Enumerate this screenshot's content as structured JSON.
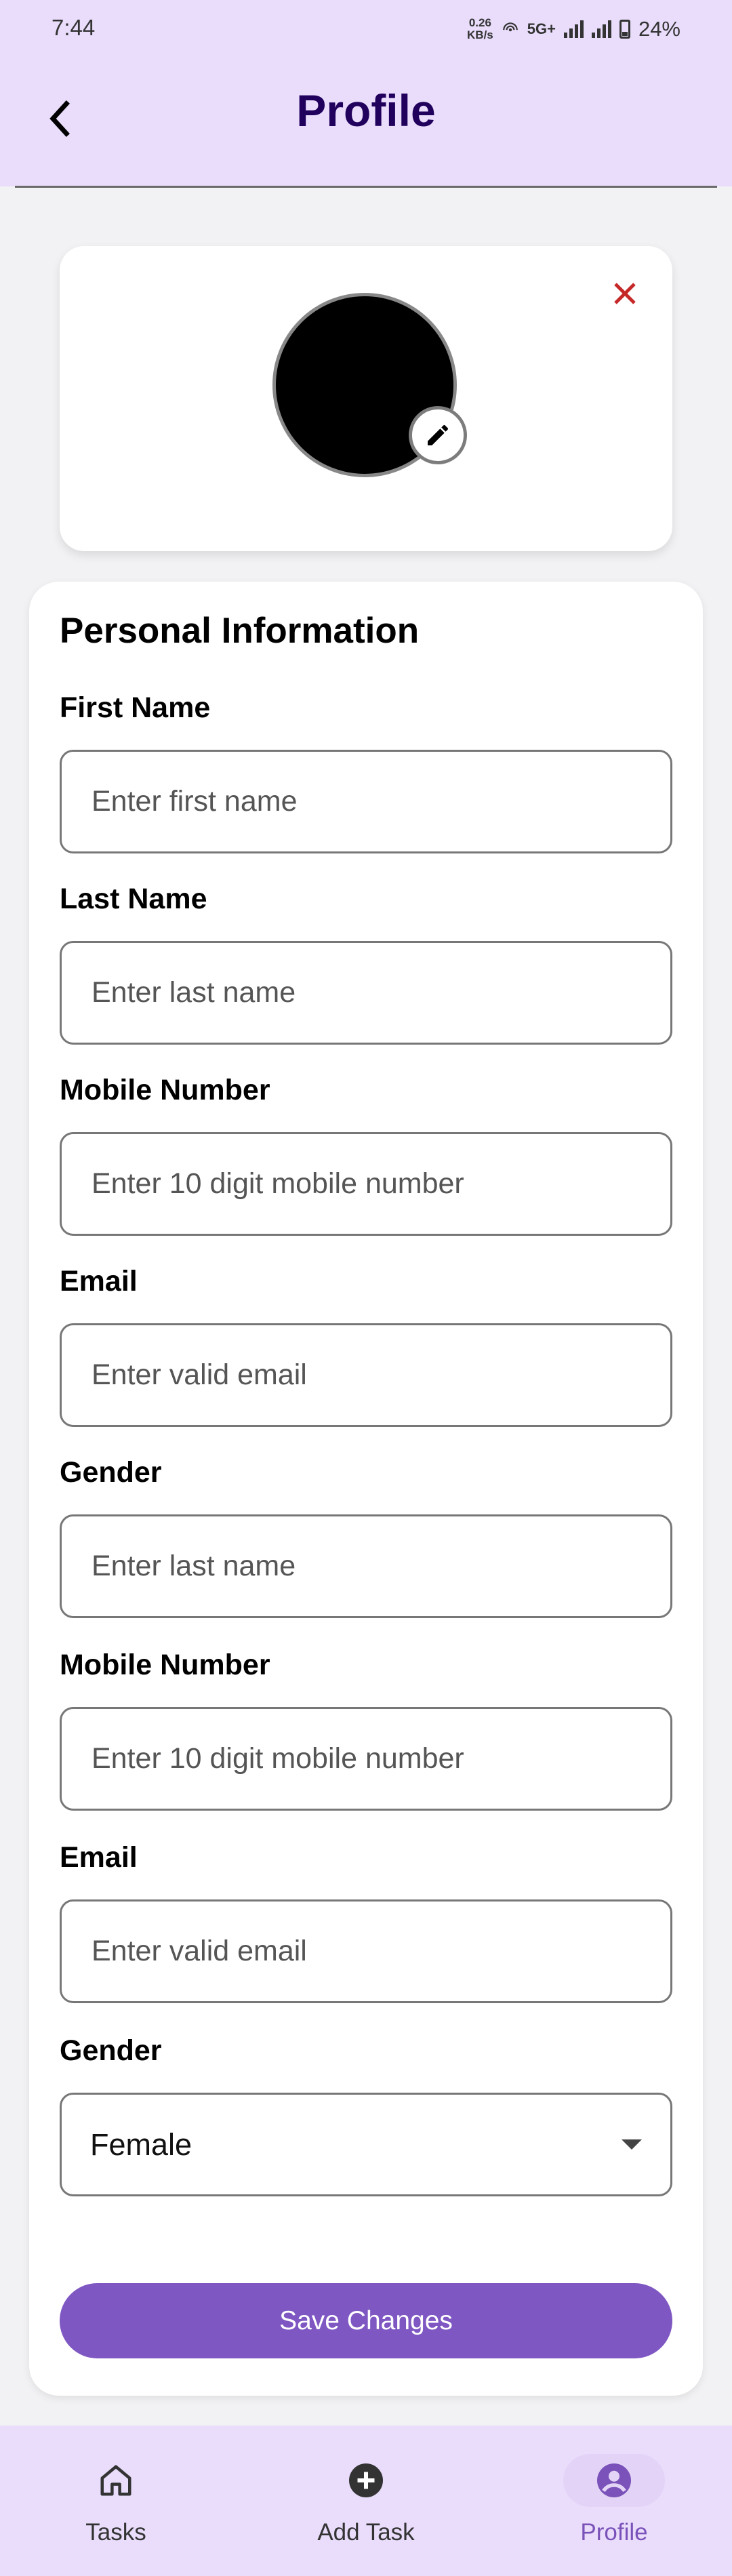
{
  "status_bar": {
    "time": "7:44",
    "speed_value": "0.26",
    "speed_unit": "KB/s",
    "network": "5G+",
    "battery": "24%"
  },
  "header": {
    "title": "Profile",
    "back_icon": "chevron-left-icon"
  },
  "avatar_card": {
    "close_icon": "close-icon",
    "edit_icon": "pencil-icon",
    "close_color": "#c62828"
  },
  "form": {
    "section_title": "Personal Information",
    "fields": [
      {
        "label": "First Name",
        "placeholder": "Enter first name",
        "value": ""
      },
      {
        "label": "Last Name",
        "placeholder": "Enter last name",
        "value": ""
      },
      {
        "label": "Mobile Number",
        "placeholder": "Enter 10 digit mobile number",
        "value": ""
      },
      {
        "label": "Email",
        "placeholder": "Enter valid email",
        "value": ""
      },
      {
        "label": "Gender",
        "placeholder": "Enter last name",
        "value": ""
      },
      {
        "label": "Mobile Number",
        "placeholder": "Enter 10 digit mobile number",
        "value": ""
      },
      {
        "label": "Email",
        "placeholder": "Enter valid email",
        "value": ""
      }
    ],
    "gender_select": {
      "label": "Gender",
      "selected": "Female"
    },
    "save_label": "Save Changes"
  },
  "bottom_nav": {
    "items": [
      {
        "label": "Tasks",
        "icon": "home-icon",
        "active": false
      },
      {
        "label": "Add Task",
        "icon": "add-circle-icon",
        "active": false
      },
      {
        "label": "Profile",
        "icon": "account-circle-icon",
        "active": true
      }
    ]
  },
  "colors": {
    "header_bg": "#e9ddfb",
    "title": "#21005d",
    "accent": "#7e57c2",
    "active_nav": "#7a52b9"
  }
}
